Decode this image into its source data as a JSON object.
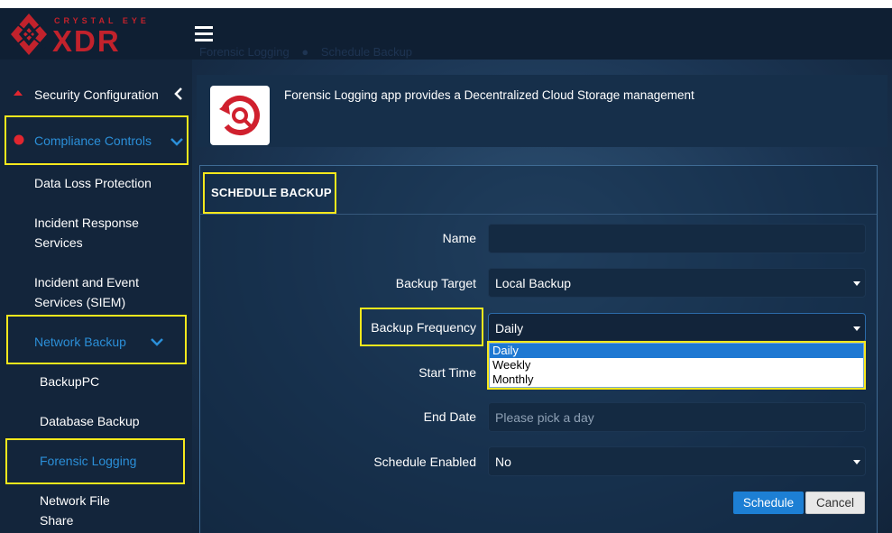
{
  "brand": {
    "line1": "CRYSTAL EYE",
    "line2": "XDR"
  },
  "breadcrumb": {
    "parent": "Forensic Logging",
    "current": "Schedule Backup"
  },
  "sidebar": {
    "security_configuration": "Security Configuration",
    "compliance_controls": "Compliance Controls",
    "data_loss_protection": "Data Loss Protection",
    "incident_response_1": "Incident Response",
    "incident_response_2": "Services",
    "incident_event_1": "Incident and Event",
    "incident_event_2": "Services (SIEM)",
    "network_backup": "Network Backup",
    "backuppc": "BackupPC",
    "database_backup": "Database Backup",
    "forensic_logging": "Forensic Logging",
    "network_file_1": "Network File",
    "network_file_2": "Share"
  },
  "app": {
    "description": "Forensic Logging app provides a Decentralized Cloud Storage management"
  },
  "panel": {
    "title": "SCHEDULE BACKUP"
  },
  "form": {
    "name_label": "Name",
    "name_value": "",
    "backup_target_label": "Backup Target",
    "backup_target_value": "Local Backup",
    "backup_frequency_label": "Backup Frequency",
    "backup_frequency_value": "Daily",
    "frequency_options": [
      "Daily",
      "Weekly",
      "Monthly"
    ],
    "start_time_label": "Start Time",
    "end_date_label": "End Date",
    "end_date_placeholder": "Please pick a day",
    "schedule_enabled_label": "Schedule Enabled",
    "schedule_enabled_value": "No"
  },
  "buttons": {
    "schedule": "Schedule",
    "cancel": "Cancel"
  },
  "colors": {
    "highlight": "#f7e81c",
    "brand_red": "#c2222c",
    "accent_blue": "#1d7fd4",
    "active_link": "#2b8fd8"
  }
}
